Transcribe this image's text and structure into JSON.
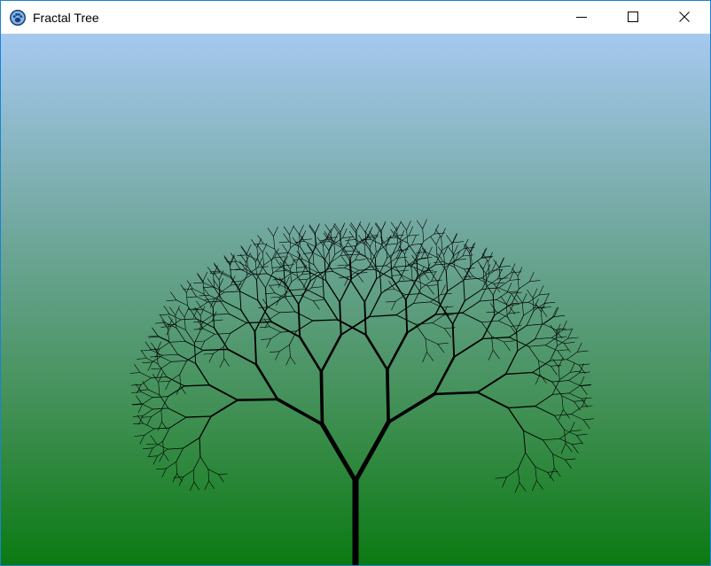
{
  "window": {
    "title": "Fractal Tree",
    "app_icon": "paw-icon",
    "controls": {
      "minimize": "minimize-icon",
      "maximize": "maximize-icon",
      "close": "close-icon"
    }
  },
  "scene": {
    "sky_color": "#a6c9ef",
    "ground_color": "#0b7a12",
    "branch_color": "#000000"
  }
}
